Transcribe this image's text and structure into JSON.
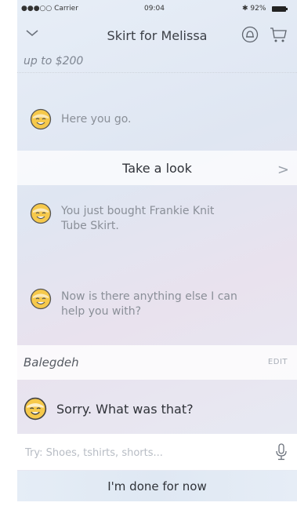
{
  "status_bar": {
    "carrier": "●●●○○ Carrier",
    "time": "09:04",
    "battery": "✱ 92%"
  },
  "nav": {
    "title": "Skirt for Melissa"
  },
  "previous_text": "up to $200",
  "messages": [
    {
      "text": "Here you go."
    },
    {
      "text": "You just bought Frankie Knit Tube Skirt."
    },
    {
      "text": "Now is there anything else I can help you with?"
    }
  ],
  "take_look": {
    "label": "Take a look",
    "chevron": ">"
  },
  "user_reply": {
    "text": "Balegdeh",
    "edit_label": "EDIT"
  },
  "bot_sorry": {
    "text": "Sorry. What was that?"
  },
  "input": {
    "placeholder": "Try: Shoes, tshirts, shorts..."
  },
  "done_button": {
    "label": "I'm done for now"
  },
  "icons": {
    "back": "chevron-down-icon",
    "bell": "notification-bell-icon",
    "cart": "shopping-cart-icon",
    "mic": "microphone-icon",
    "avatar": "smiley-face-icon"
  },
  "colors": {
    "avatar_yellow": "#f6c94b",
    "text_dark": "#2f3238",
    "text_muted": "#8a8f98"
  }
}
